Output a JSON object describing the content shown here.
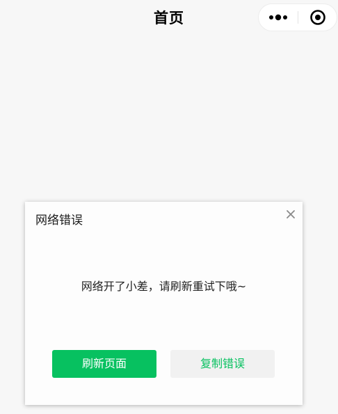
{
  "navbar": {
    "title": "首页",
    "more_icon": "more-dots-icon",
    "close_icon": "target-close-icon"
  },
  "dialog": {
    "title": "网络错误",
    "close_icon": "close-x-icon",
    "message": "网络开了小差，请刷新重试下哦~",
    "refresh_label": "刷新页面",
    "copy_label": "复制错误"
  },
  "colors": {
    "background": "#f7f7f7",
    "accent_green": "#07c160",
    "dialog_background": "#fdfdfd",
    "secondary_button": "#f1f1f1"
  }
}
